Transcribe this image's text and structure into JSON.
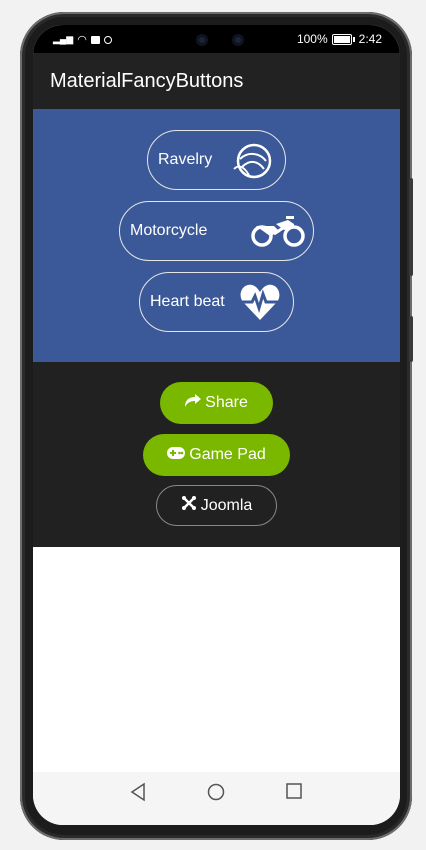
{
  "status": {
    "battery_percent": "100%",
    "time": "2:42"
  },
  "appbar": {
    "title": "MaterialFancyButtons"
  },
  "fancy_buttons": [
    {
      "label": "Ravelry",
      "icon": "ravelry-icon"
    },
    {
      "label": "Motorcycle",
      "icon": "motorcycle-icon"
    },
    {
      "label": "Heart beat",
      "icon": "heartbeat-icon"
    }
  ],
  "pill_buttons": [
    {
      "label": "Share",
      "icon": "share-icon",
      "color": "#7ab800"
    },
    {
      "label": "Game Pad",
      "icon": "gamepad-icon",
      "color": "#7ab800"
    },
    {
      "label": "Joomla",
      "icon": "joomla-icon",
      "color": "#212121"
    }
  ],
  "colors": {
    "blue_section": "#3b5998",
    "dark_section": "#212121",
    "appbar": "#222222",
    "green": "#7ab800"
  },
  "navigation": {
    "back": "back-icon",
    "home": "home-icon",
    "recents": "recents-icon"
  }
}
